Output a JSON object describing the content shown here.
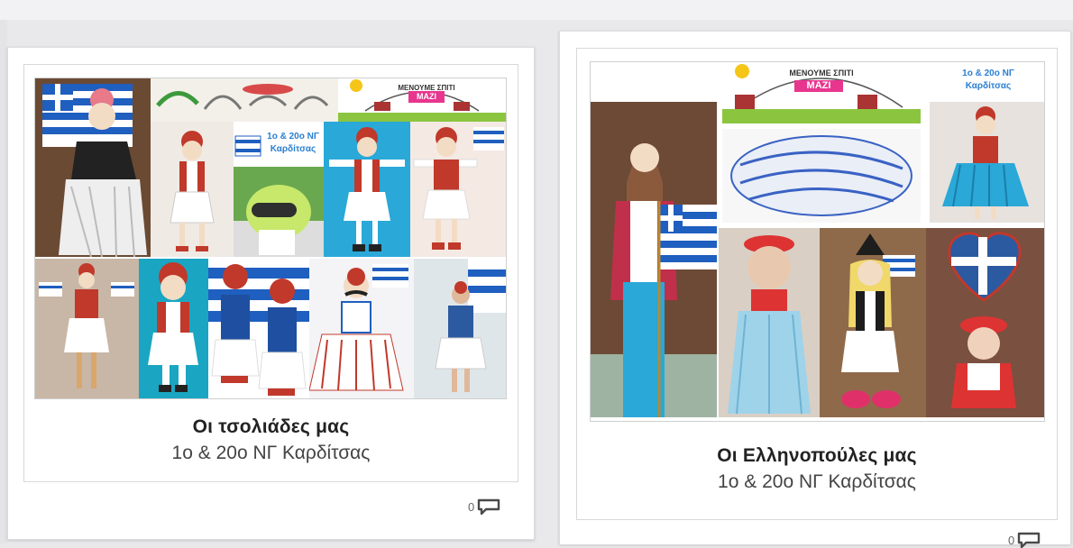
{
  "cards": [
    {
      "title": "Οι τσολιάδες μας",
      "subtitle": "1ο & 20ο ΝΓ Καρδίτσας",
      "comment_count": "0",
      "collage_label_line1": "1ο & 20ο ΝΓ",
      "collage_label_line2": "Καρδίτσας",
      "banner_text_top": "ΜΕΝΟΥΜΕ ΣΠΙΤΙ",
      "banner_text_main": "ΜΑΖΙ"
    },
    {
      "title": "Οι Ελληνοπούλες μας",
      "subtitle": "1ο & 20ο ΝΓ Καρδίτσας",
      "comment_count": "0",
      "collage_label_line1": "1ο & 20ο ΝΓ",
      "collage_label_line2": "Καρδίτσας",
      "banner_text_top": "ΜΕΝΟΥΜΕ ΣΠΙΤΙ",
      "banner_text_main": "ΜΑΖΙ"
    }
  ],
  "icons": {
    "comments": "speech-bubble-icon"
  },
  "colors": {
    "greek_blue": "#1f5fbf",
    "label_blue": "#2a7fd1",
    "banner_green": "#8bc53f"
  }
}
